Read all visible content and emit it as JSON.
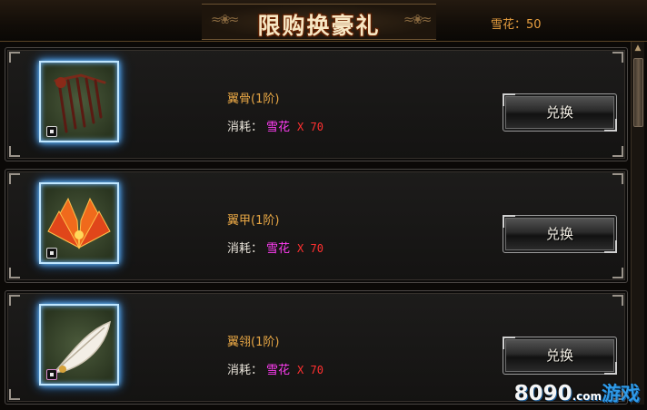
{
  "header": {
    "title": "限购换豪礼",
    "currency_label": "雪花：50"
  },
  "items": [
    {
      "name": "翼骨(1阶)",
      "cost_label": "消耗：",
      "cost_item": "雪花",
      "cost_amount": "X 70",
      "button": "兑换",
      "icon": "wing-bone-icon"
    },
    {
      "name": "翼甲(1阶)",
      "cost_label": "消耗：",
      "cost_item": "雪花",
      "cost_amount": "X 70",
      "button": "兑换",
      "icon": "wing-armor-icon"
    },
    {
      "name": "翼翎(1阶)",
      "cost_label": "消耗：",
      "cost_item": "雪花",
      "cost_amount": "X 70",
      "button": "兑换",
      "icon": "wing-feather-icon"
    }
  ],
  "watermark": {
    "num": "8090",
    "com": ".com",
    "game": "游戏"
  },
  "colors": {
    "accent": "#e8a745",
    "item": "#ff3df3",
    "amount": "#ff3030",
    "glow": "#74c6ff"
  }
}
